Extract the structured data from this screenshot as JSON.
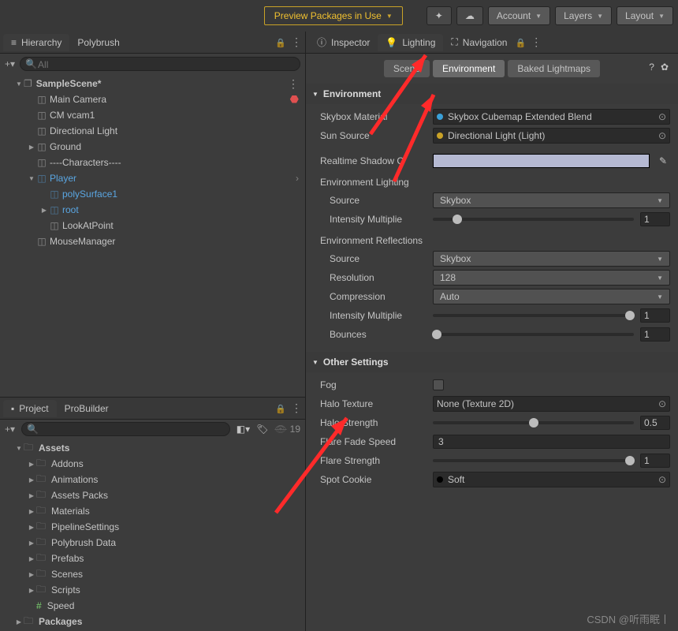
{
  "topbar": {
    "preview_label": "Preview Packages in Use",
    "account": "Account",
    "layers": "Layers",
    "layout": "Layout"
  },
  "left_tabs": {
    "hierarchy": "Hierarchy",
    "polybrush": "Polybrush"
  },
  "search": {
    "placeholder": "All"
  },
  "hierarchy": {
    "scene": "SampleScene*",
    "items": [
      "Main Camera",
      "CM vcam1",
      "Directional Light",
      "Ground",
      "----Characters----",
      "Player",
      "polySurface1",
      "root",
      "LookAtPoint",
      "MouseManager"
    ]
  },
  "project_tabs": {
    "project": "Project",
    "probuilder": "ProBuilder"
  },
  "project_count": "19",
  "assets_root": "Assets",
  "assets": [
    "Addons",
    "Animations",
    "Assets Packs",
    "Materials",
    "PipelineSettings",
    "Polybrush Data",
    "Prefabs",
    "Scenes",
    "Scripts"
  ],
  "speed_item": "Speed",
  "packages_root": "Packages",
  "right_tabs": {
    "inspector": "Inspector",
    "lighting": "Lighting",
    "navigation": "Navigation"
  },
  "subtabs": {
    "scene": "Scene",
    "environment": "Environment",
    "baked": "Baked Lightmaps"
  },
  "env": {
    "title": "Environment",
    "skybox_lbl": "Skybox Material",
    "skybox_val": "Skybox Cubemap Extended Blend",
    "sun_lbl": "Sun Source",
    "sun_val": "Directional Light (Light)",
    "shadow_lbl": "Realtime Shadow C",
    "env_lighting": "Environment Lighting",
    "source_lbl": "Source",
    "source_val": "Skybox",
    "intensity_lbl": "Intensity Multiplie",
    "intensity_val": "1",
    "env_refl": "Environment Reflections",
    "refl_source_lbl": "Source",
    "refl_source_val": "Skybox",
    "resolution_lbl": "Resolution",
    "resolution_val": "128",
    "compression_lbl": "Compression",
    "compression_val": "Auto",
    "refl_intensity_lbl": "Intensity Multiplie",
    "refl_intensity_val": "1",
    "bounces_lbl": "Bounces",
    "bounces_val": "1"
  },
  "other": {
    "title": "Other Settings",
    "fog_lbl": "Fog",
    "halo_tex_lbl": "Halo Texture",
    "halo_tex_val": "None (Texture 2D)",
    "halo_str_lbl": "Halo Strength",
    "halo_str_val": "0.5",
    "flare_fade_lbl": "Flare Fade Speed",
    "flare_fade_val": "3",
    "flare_str_lbl": "Flare Strength",
    "flare_str_val": "1",
    "spot_lbl": "Spot Cookie",
    "spot_val": "Soft"
  },
  "watermark": "CSDN @听雨眠丨"
}
